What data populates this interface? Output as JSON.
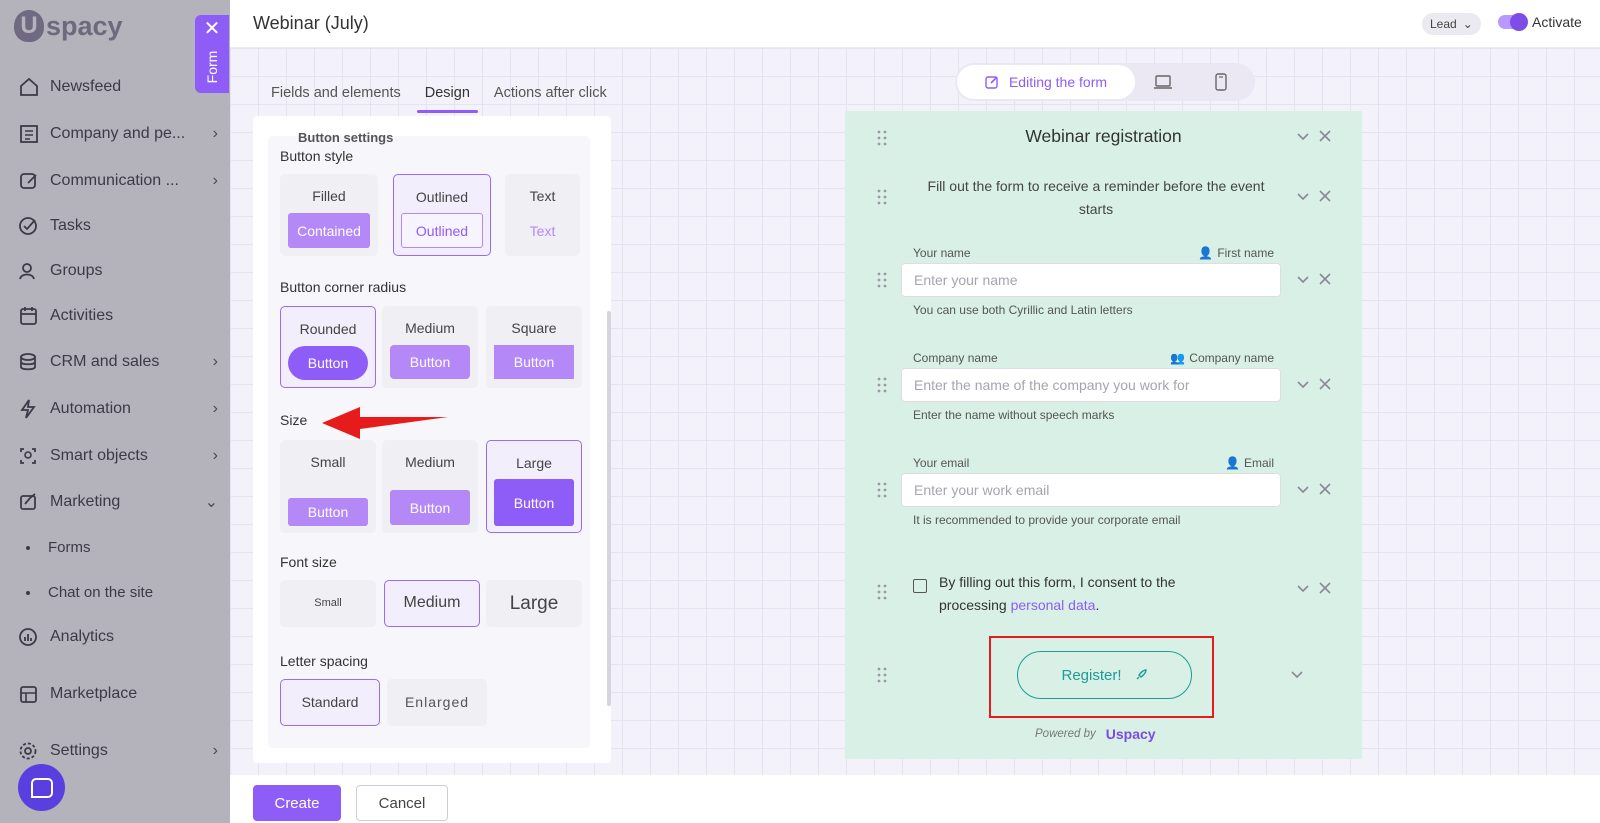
{
  "sidebar": {
    "logo_text": "spacy",
    "items": [
      {
        "label": "Newsfeed",
        "icon": "house-icon",
        "chevron": ""
      },
      {
        "label": "Company and pe...",
        "icon": "company-icon",
        "chevron": "›"
      },
      {
        "label": "Communication ...",
        "icon": "communication-icon",
        "chevron": "›"
      },
      {
        "label": "Tasks",
        "icon": "check-circle-icon",
        "chevron": ""
      },
      {
        "label": "Groups",
        "icon": "groups-icon",
        "chevron": ""
      },
      {
        "label": "Activities",
        "icon": "calendar-icon",
        "chevron": ""
      },
      {
        "label": "CRM and sales",
        "icon": "database-icon",
        "chevron": "›"
      },
      {
        "label": "Automation",
        "icon": "lightning-icon",
        "chevron": "›"
      },
      {
        "label": "Smart objects",
        "icon": "smart-objects-icon",
        "chevron": "›"
      },
      {
        "label": "Marketing",
        "icon": "marketing-icon",
        "chevron": "⌄"
      },
      {
        "label": "Analytics",
        "icon": "analytics-icon",
        "chevron": ""
      },
      {
        "label": "Marketplace",
        "icon": "marketplace-icon",
        "chevron": ""
      },
      {
        "label": "Settings",
        "icon": "gear-icon",
        "chevron": "›"
      }
    ],
    "sub_items": [
      "Forms",
      "Chat on the site"
    ]
  },
  "form_tab": {
    "label": "Form",
    "close": "✕"
  },
  "header": {
    "title": "Webinar (July)",
    "lead_select": "Lead",
    "activate_label": "Activate"
  },
  "tabs": [
    {
      "label": "Fields and elements",
      "active": false
    },
    {
      "label": "Design",
      "active": true
    },
    {
      "label": "Actions after click",
      "active": false
    }
  ],
  "panel": {
    "cut_title": "Button settings",
    "button_style": {
      "label": "Button style",
      "options": [
        {
          "caption": "Filled",
          "preview": "Contained",
          "selected": false
        },
        {
          "caption": "Outlined",
          "preview": "Outlined",
          "selected": true
        },
        {
          "caption": "Text",
          "preview": "Text",
          "selected": false
        }
      ]
    },
    "corner_radius": {
      "label": "Button corner radius",
      "options": [
        {
          "caption": "Rounded",
          "preview": "Button",
          "selected": true
        },
        {
          "caption": "Medium",
          "preview": "Button",
          "selected": false
        },
        {
          "caption": "Square",
          "preview": "Button",
          "selected": false
        }
      ]
    },
    "size": {
      "label": "Size",
      "options": [
        {
          "caption": "Small",
          "preview": "Button",
          "selected": false
        },
        {
          "caption": "Medium",
          "preview": "Button",
          "selected": false
        },
        {
          "caption": "Large",
          "preview": "Button",
          "selected": true
        }
      ]
    },
    "font_size": {
      "label": "Font size",
      "options": [
        {
          "caption": "Small",
          "selected": false
        },
        {
          "caption": "Medium",
          "selected": true
        },
        {
          "caption": "Large",
          "selected": false
        }
      ]
    },
    "letter_spacing": {
      "label": "Letter spacing",
      "options": [
        {
          "caption": "Standard",
          "selected": true
        },
        {
          "caption": "Enlarged",
          "selected": false
        }
      ]
    }
  },
  "footer": {
    "create_label": "Create",
    "cancel_label": "Cancel"
  },
  "view_switch": {
    "edit_label": "Editing the form",
    "active": "edit"
  },
  "form": {
    "title": "Webinar registration",
    "description": "Fill out the form to receive a reminder before the event starts",
    "fields": [
      {
        "label": "Your name",
        "mapping": "First name",
        "placeholder": "Enter your name",
        "hint": "You can use both Cyrillic and Latin letters"
      },
      {
        "label": "Company name",
        "mapping": "Company name",
        "placeholder": "Enter the name of the company you work for",
        "hint": "Enter the name without speech marks"
      },
      {
        "label": "Your email",
        "mapping": "Email",
        "placeholder": "Enter your work email",
        "hint": "It is recommended to provide your corporate email"
      }
    ],
    "consent_text": "By filling out this form, I consent to the processing ",
    "consent_link": "personal data",
    "consent_end": ".",
    "register_label": "Register!",
    "powered_by": "Powered by",
    "brand": "spacy"
  },
  "colors": {
    "accent": "#8e5cf7",
    "preview_bg": "#d9f0e6",
    "register_teal": "#1d9c97",
    "annotation_red": "#e61c1c"
  }
}
